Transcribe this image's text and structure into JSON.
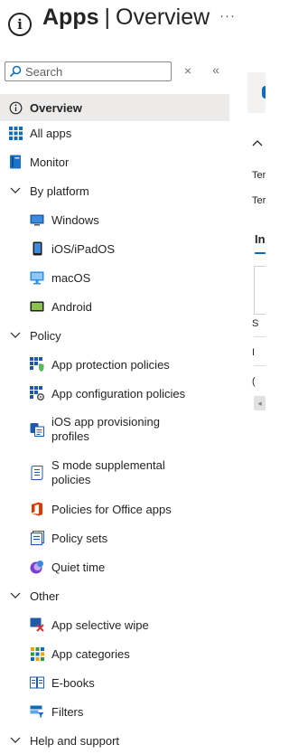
{
  "header": {
    "title_bold": "Apps",
    "title_separator": "|",
    "title_rest": "Overview",
    "more_label": "···",
    "info_glyph": "i"
  },
  "search": {
    "placeholder": "Search",
    "value": "",
    "clear_glyph": "×",
    "collapse_glyph": "«"
  },
  "nav": {
    "items": [
      {
        "label": "Overview",
        "icon": "info-icon",
        "selected": true
      },
      {
        "label": "All apps",
        "icon": "grid-apps-icon"
      },
      {
        "label": "Monitor",
        "icon": "monitor-book-icon"
      },
      {
        "label": "By platform",
        "icon": "chevron-down-icon",
        "group": true
      },
      {
        "label": "Windows",
        "icon": "windows-device-icon"
      },
      {
        "label": "iOS/iPadOS",
        "icon": "phone-device-icon"
      },
      {
        "label": "macOS",
        "icon": "mac-monitor-icon"
      },
      {
        "label": "Android",
        "icon": "android-device-icon"
      },
      {
        "label": "Policy",
        "icon": "chevron-down-icon",
        "group": true
      },
      {
        "label": "App protection policies",
        "icon": "app-protection-icon"
      },
      {
        "label": "App configuration policies",
        "icon": "app-configuration-icon"
      },
      {
        "label": "iOS app provisioning profiles",
        "icon": "provisioning-profile-icon"
      },
      {
        "label": "S mode supplemental policies",
        "icon": "document-policy-icon"
      },
      {
        "label": "Policies for Office apps",
        "icon": "office-icon"
      },
      {
        "label": "Policy sets",
        "icon": "policy-sets-icon"
      },
      {
        "label": "Quiet time",
        "icon": "quiet-time-icon"
      },
      {
        "label": "Other",
        "icon": "chevron-down-icon",
        "group": true
      },
      {
        "label": "App selective wipe",
        "icon": "selective-wipe-icon"
      },
      {
        "label": "App categories",
        "icon": "categories-grid-icon"
      },
      {
        "label": "E-books",
        "icon": "ebook-icon"
      },
      {
        "label": "Filters",
        "icon": "filter-icon"
      },
      {
        "label": "Help and support",
        "icon": "chevron-down-icon",
        "group": true
      }
    ]
  },
  "right_panel": {
    "row1": "Ter",
    "row2": "Ter",
    "tab": "In",
    "list_marker_1": "S",
    "list_marker_2": "I",
    "list_marker_3": "("
  },
  "colors": {
    "accent": "#0f6cbd",
    "selected_bg": "#ecebea",
    "text": "#242424"
  }
}
